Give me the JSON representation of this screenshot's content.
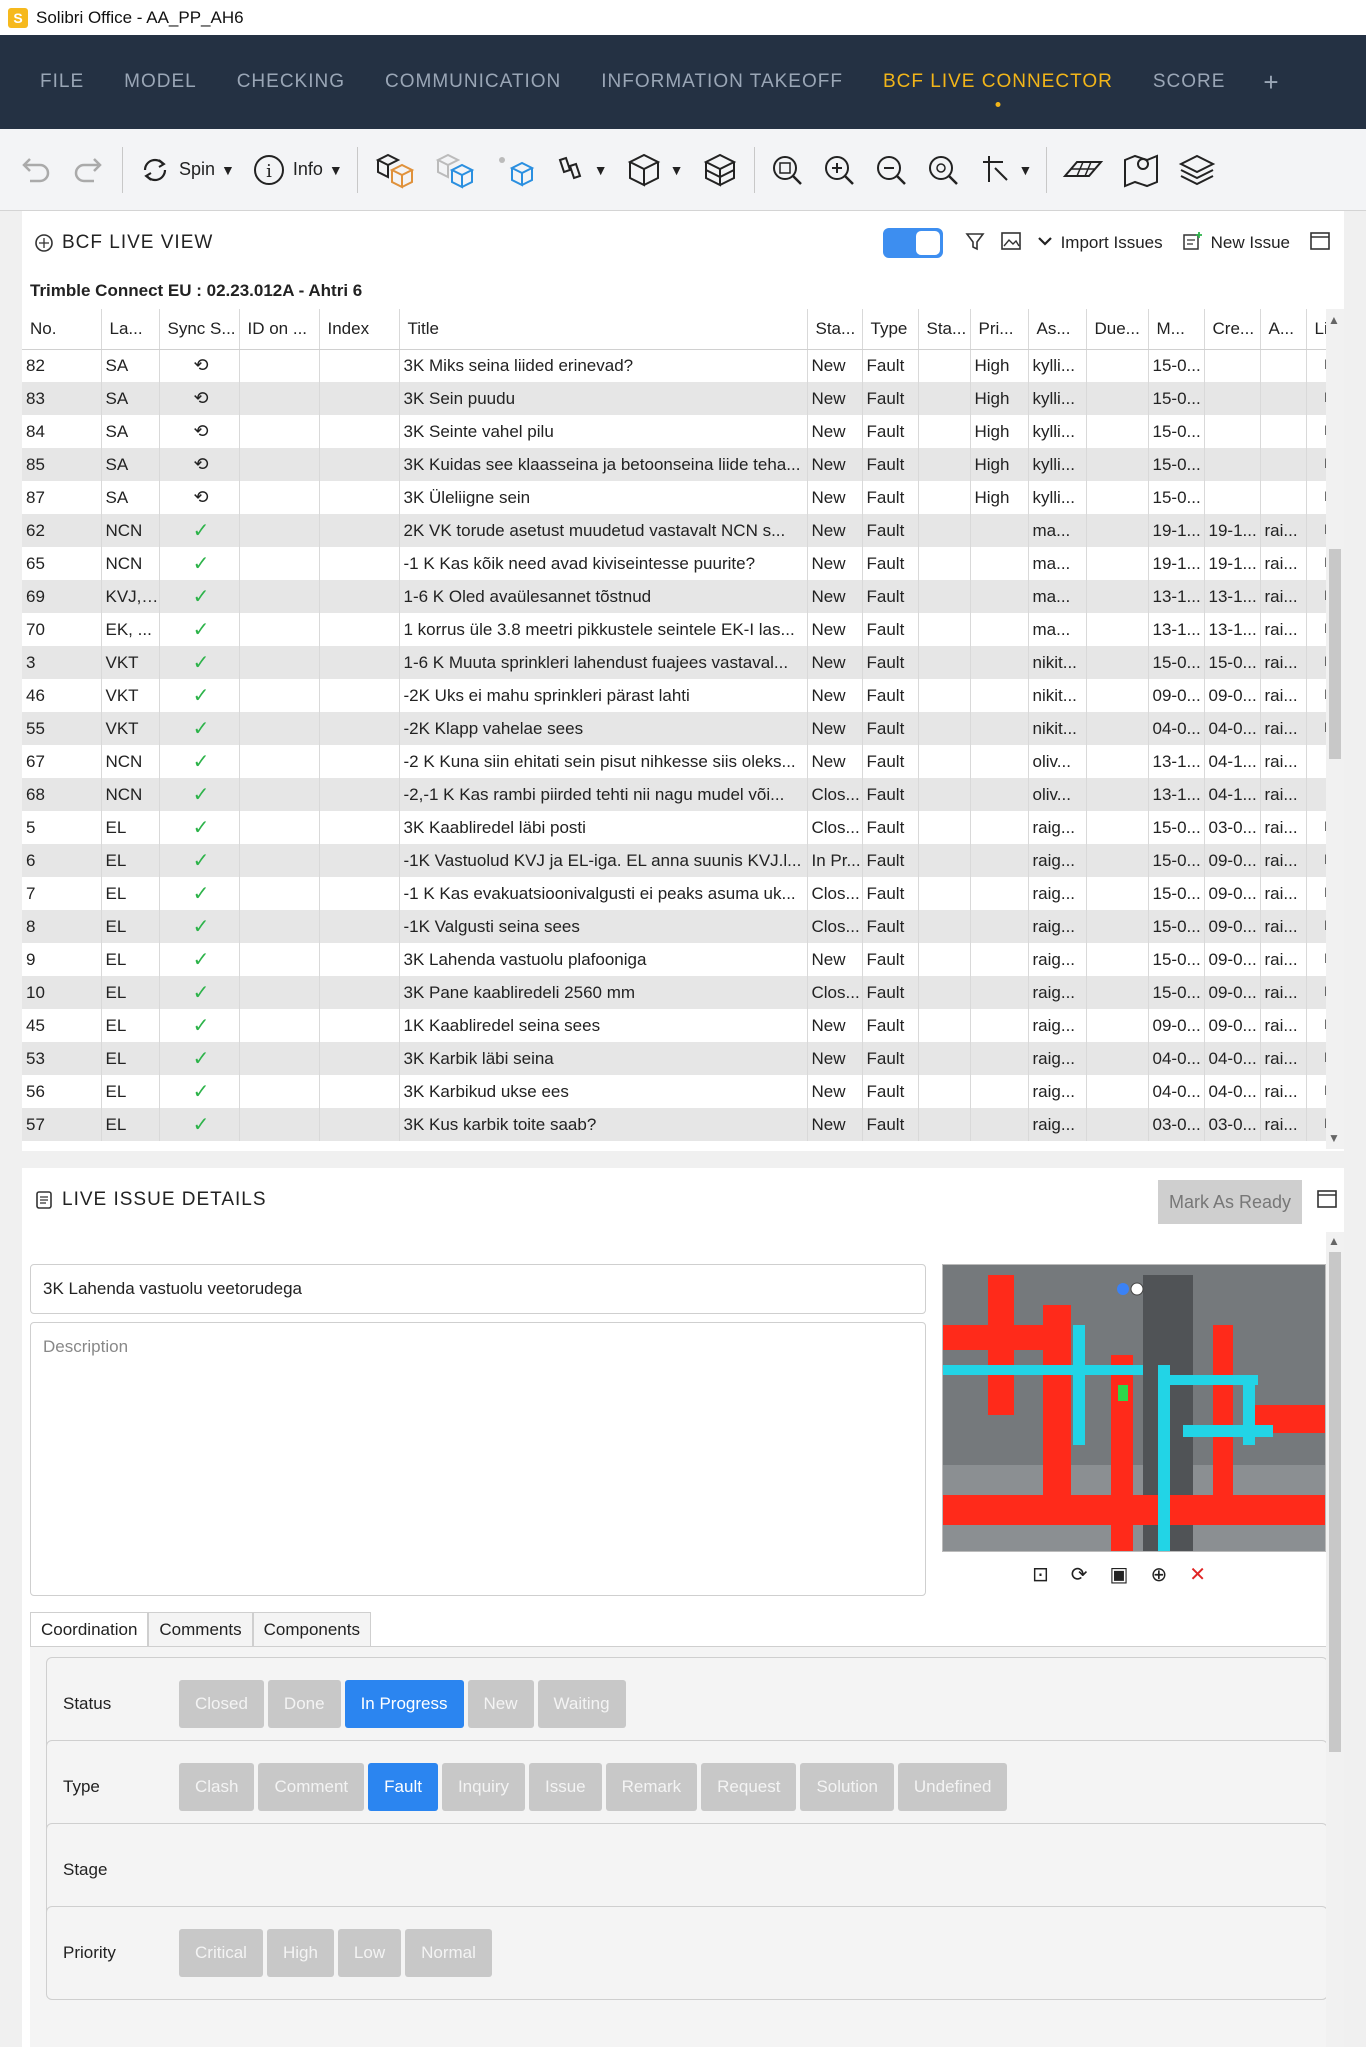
{
  "window": {
    "title": "Solibri Office - AA_PP_AH6",
    "logo_letter": "S"
  },
  "menu": {
    "items": [
      "FILE",
      "MODEL",
      "CHECKING",
      "COMMUNICATION",
      "INFORMATION TAKEOFF",
      "BCF LIVE CONNECTOR",
      "SCORE"
    ],
    "active_index": 5,
    "plus": "+"
  },
  "toolbar": {
    "spin_label": "Spin",
    "info_label": "Info"
  },
  "live_view": {
    "title": "BCF LIVE VIEW",
    "import_label": "Import Issues",
    "new_issue_label": "New Issue",
    "connection": "Trimble Connect EU : 02.23.012A - Ahtri 6",
    "columns": [
      "No.",
      "La...",
      "Sync S...",
      "ID on ...",
      "Index",
      "Title",
      "Sta...",
      "Type",
      "Sta...",
      "Pri...",
      "As...",
      "Due...",
      "M...",
      "Cre...",
      "A...",
      "Li..."
    ],
    "rows": [
      [
        "82",
        "SA",
        "pending",
        "",
        "",
        "3K Miks seina liided erinevad?",
        "New",
        "Fault",
        "",
        "High",
        "kylli...",
        "",
        "15-0...",
        "",
        "",
        "link"
      ],
      [
        "83",
        "SA",
        "pending",
        "",
        "",
        "3K Sein puudu",
        "New",
        "Fault",
        "",
        "High",
        "kylli...",
        "",
        "15-0...",
        "",
        "",
        "link"
      ],
      [
        "84",
        "SA",
        "pending",
        "",
        "",
        "3K Seinte vahel pilu",
        "New",
        "Fault",
        "",
        "High",
        "kylli...",
        "",
        "15-0...",
        "",
        "",
        "link"
      ],
      [
        "85",
        "SA",
        "pending",
        "",
        "",
        "3K Kuidas see klaasseina ja betoonseina liide teha...",
        "New",
        "Fault",
        "",
        "High",
        "kylli...",
        "",
        "15-0...",
        "",
        "",
        "link"
      ],
      [
        "87",
        "SA",
        "pending",
        "",
        "",
        "3K Üleliigne sein",
        "New",
        "Fault",
        "",
        "High",
        "kylli...",
        "",
        "15-0...",
        "",
        "",
        "link"
      ],
      [
        "62",
        "NCN",
        "ok",
        "",
        "",
        "2K VK torude asetust muudetud vastavalt NCN s...",
        "New",
        "Fault",
        "",
        "",
        "ma...",
        "",
        "19-1...",
        "19-1...",
        "rai...",
        "link"
      ],
      [
        "65",
        "NCN",
        "ok",
        "",
        "",
        "-1 K Kas kõik need avad kiviseintesse puurite?",
        "New",
        "Fault",
        "",
        "",
        "ma...",
        "",
        "19-1...",
        "19-1...",
        "rai...",
        "link"
      ],
      [
        "69",
        "KVJ, ...",
        "ok",
        "",
        "",
        "1-6 K Oled avaülesannet tõstnud",
        "New",
        "Fault",
        "",
        "",
        "ma...",
        "",
        "13-1...",
        "13-1...",
        "rai...",
        "link"
      ],
      [
        "70",
        "EK, ...",
        "ok",
        "",
        "",
        "1 korrus üle 3.8 meetri pikkustele seintele EK-I las...",
        "New",
        "Fault",
        "",
        "",
        "ma...",
        "",
        "13-1...",
        "13-1...",
        "rai...",
        "link"
      ],
      [
        "3",
        "VKT",
        "ok",
        "",
        "",
        "1-6 K Muuta sprinkleri lahendust fuajees vastaval...",
        "New",
        "Fault",
        "",
        "",
        "nikit...",
        "",
        "15-0...",
        "15-0...",
        "rai...",
        "link"
      ],
      [
        "46",
        "VKT",
        "ok",
        "",
        "",
        "-2K Uks ei mahu sprinkleri pärast lahti",
        "New",
        "Fault",
        "",
        "",
        "nikit...",
        "",
        "09-0...",
        "09-0...",
        "rai...",
        "link"
      ],
      [
        "55",
        "VKT",
        "ok",
        "",
        "",
        "-2K Klapp vahelae sees",
        "New",
        "Fault",
        "",
        "",
        "nikit...",
        "",
        "04-0...",
        "04-0...",
        "rai...",
        "link"
      ],
      [
        "67",
        "NCN",
        "ok",
        "",
        "",
        "-2 K Kuna siin ehitati sein pisut nihkesse siis oleks...",
        "New",
        "Fault",
        "",
        "",
        "oliv...",
        "",
        "13-1...",
        "04-1...",
        "rai...",
        ""
      ],
      [
        "68",
        "NCN",
        "ok",
        "",
        "",
        "-2,-1 K Kas rambi piirded tehti nii nagu mudel või...",
        "Clos...",
        "Fault",
        "",
        "",
        "oliv...",
        "",
        "13-1...",
        "04-1...",
        "rai...",
        ""
      ],
      [
        "5",
        "EL",
        "ok",
        "",
        "",
        "3K Kaabliredel läbi posti",
        "Clos...",
        "Fault",
        "",
        "",
        "raig...",
        "",
        "15-0...",
        "03-0...",
        "rai...",
        "link"
      ],
      [
        "6",
        "EL",
        "ok",
        "",
        "",
        "-1K Vastuolud KVJ ja EL-iga. EL anna suunis KVJ.l...",
        "In Pr...",
        "Fault",
        "",
        "",
        "raig...",
        "",
        "15-0...",
        "09-0...",
        "rai...",
        "link"
      ],
      [
        "7",
        "EL",
        "ok",
        "",
        "",
        "-1 K Kas evakuatsioonivalgusti ei peaks asuma uk...",
        "Clos...",
        "Fault",
        "",
        "",
        "raig...",
        "",
        "15-0...",
        "09-0...",
        "rai...",
        "link"
      ],
      [
        "8",
        "EL",
        "ok",
        "",
        "",
        "-1K Valgusti seina sees",
        "Clos...",
        "Fault",
        "",
        "",
        "raig...",
        "",
        "15-0...",
        "09-0...",
        "rai...",
        "link"
      ],
      [
        "9",
        "EL",
        "ok",
        "",
        "",
        "3K Lahenda vastuolu plafooniga",
        "New",
        "Fault",
        "",
        "",
        "raig...",
        "",
        "15-0...",
        "09-0...",
        "rai...",
        "link"
      ],
      [
        "10",
        "EL",
        "ok",
        "",
        "",
        "3K Pane kaabliredeli 2560 mm",
        "Clos...",
        "Fault",
        "",
        "",
        "raig...",
        "",
        "15-0...",
        "09-0...",
        "rai...",
        "link"
      ],
      [
        "45",
        "EL",
        "ok",
        "",
        "",
        "1K Kaabliredel seina sees",
        "New",
        "Fault",
        "",
        "",
        "raig...",
        "",
        "09-0...",
        "09-0...",
        "rai...",
        "link"
      ],
      [
        "53",
        "EL",
        "ok",
        "",
        "",
        "3K Karbik läbi seina",
        "New",
        "Fault",
        "",
        "",
        "raig...",
        "",
        "04-0...",
        "04-0...",
        "rai...",
        "link"
      ],
      [
        "56",
        "EL",
        "ok",
        "",
        "",
        "3K Karbikud ukse ees",
        "New",
        "Fault",
        "",
        "",
        "raig...",
        "",
        "04-0...",
        "04-0...",
        "rai...",
        "link"
      ],
      [
        "57",
        "EL",
        "ok",
        "",
        "",
        "3K Kus karbik toite saab?",
        "New",
        "Fault",
        "",
        "",
        "raig...",
        "",
        "03-0...",
        "03-0...",
        "rai...",
        "link"
      ]
    ]
  },
  "details": {
    "title": "LIVE ISSUE DETAILS",
    "mark_ready_label": "Mark As Ready",
    "issue_title": "3K Lahenda vastuolu veetorudega",
    "description_placeholder": "Description",
    "tabs": [
      "Coordination",
      "Comments",
      "Components"
    ],
    "active_tab": 0,
    "fields": [
      {
        "label": "Status",
        "options": [
          "Closed",
          "Done",
          "In Progress",
          "New",
          "Waiting"
        ],
        "selected": "In Progress"
      },
      {
        "label": "Type",
        "options": [
          "Clash",
          "Comment",
          "Fault",
          "Inquiry",
          "Issue",
          "Remark",
          "Request",
          "Solution",
          "Undefined"
        ],
        "selected": "Fault"
      },
      {
        "label": "Stage",
        "options": [],
        "selected": ""
      },
      {
        "label": "Priority",
        "options": [
          "Critical",
          "High",
          "Low",
          "Normal"
        ],
        "selected": ""
      }
    ]
  },
  "colors": {
    "menubar": "#243143",
    "accent": "#f2b519",
    "toggle": "#3d8ef0",
    "selected_chip": "#2b85f0",
    "sync_ok": "#2db34a",
    "delete": "#e02424"
  }
}
